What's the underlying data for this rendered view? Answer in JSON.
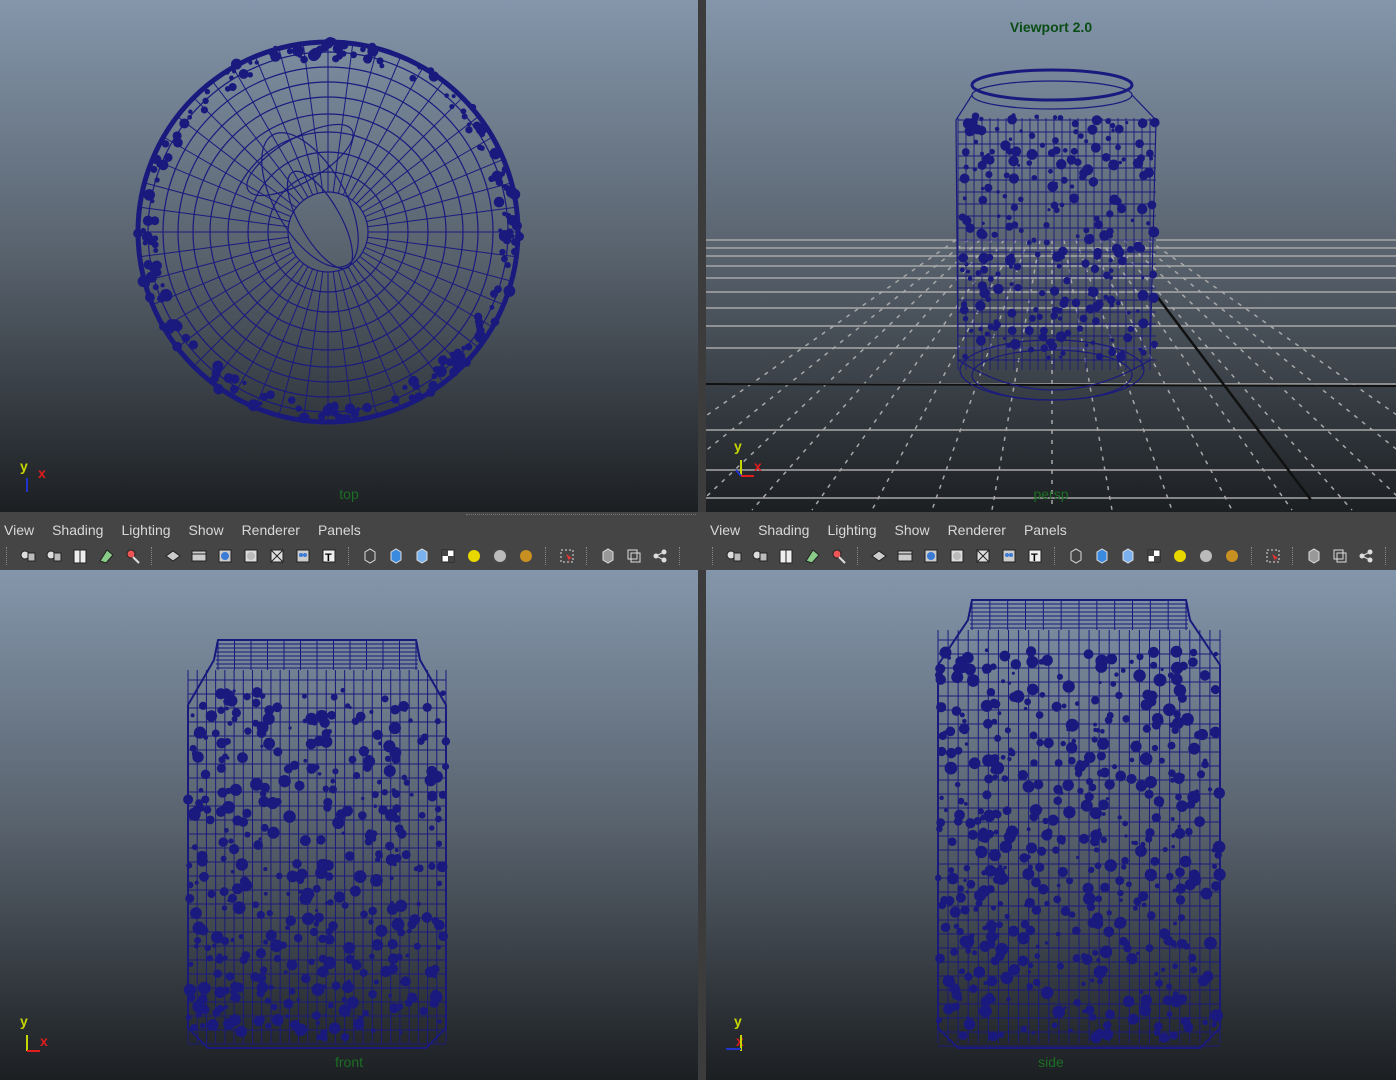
{
  "viewports": {
    "top": {
      "camera": "top"
    },
    "persp": {
      "camera": "persp",
      "renderer": "Viewport 2.0"
    },
    "front": {
      "camera": "front"
    },
    "side": {
      "camera": "side"
    }
  },
  "axis": {
    "y": "y",
    "x": "x"
  },
  "panel_menu": {
    "view": "View",
    "shading": "Shading",
    "lighting": "Lighting",
    "show": "Show",
    "renderer": "Renderer",
    "panels": "Panels"
  },
  "colors": {
    "wireframe": "#1a1a7e",
    "grid": "#a8a8a8",
    "camera_label": "#1b6e23",
    "axis_y": "#c6d600",
    "axis_x": "#e21c1c",
    "toolbar_bg": "#454545"
  },
  "toolbar_icons": [
    "camera-select-icon",
    "camera-lock-icon",
    "bookmarks-icon",
    "image-plane-icon",
    "grease-pencil-icon",
    "grid-icon",
    "film-gate-icon",
    "resolution-gate-icon",
    "gate-mask-icon",
    "field-chart-icon",
    "safe-action-icon",
    "safe-title-icon",
    "wireframe-icon",
    "smooth-shade-icon",
    "flat-shade-icon",
    "textured-icon",
    "use-lights-icon",
    "shadows-icon",
    "screen-space-ao-icon",
    "isolate-select-icon",
    "xray-icon",
    "xray-joints-icon",
    "xray-components-icon"
  ]
}
